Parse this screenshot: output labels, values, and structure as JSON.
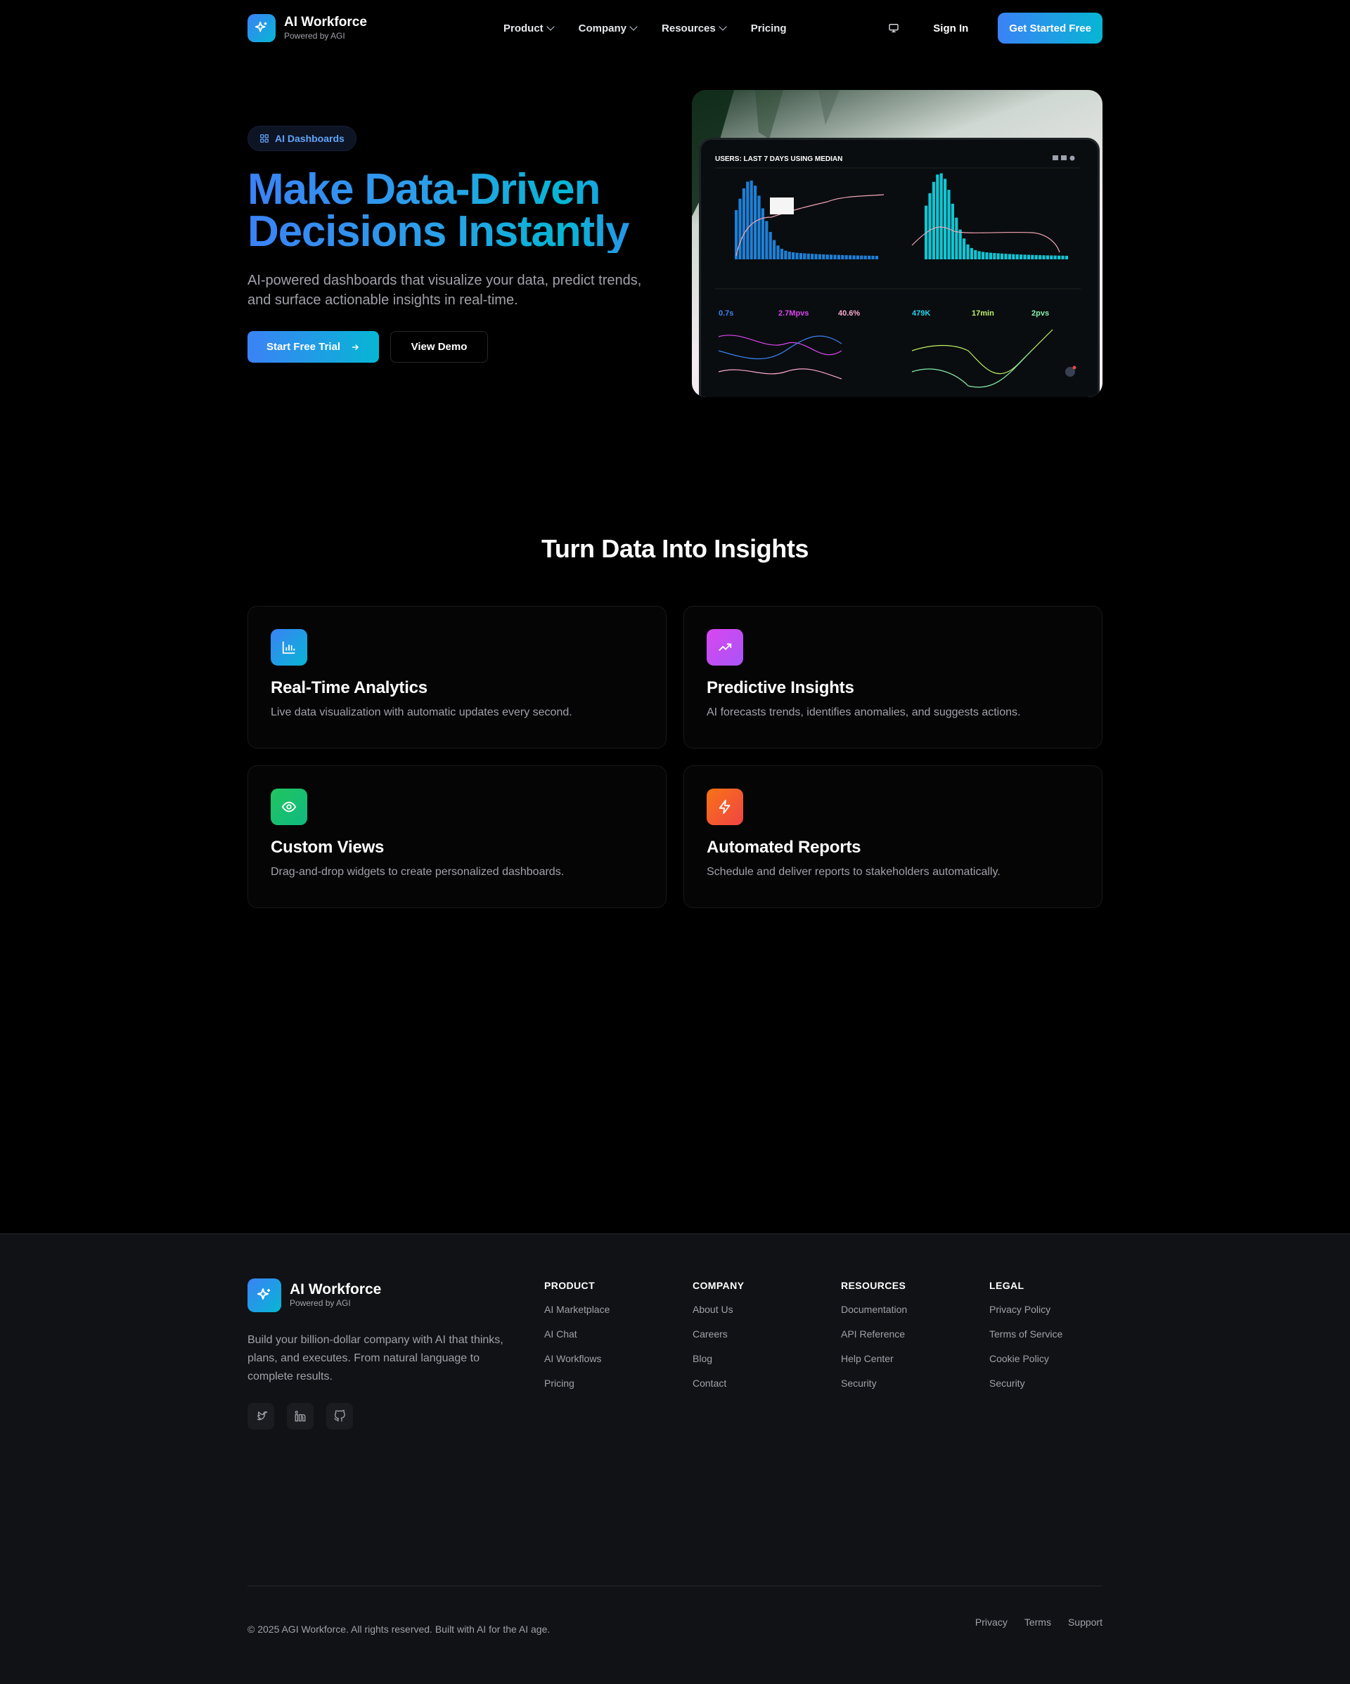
{
  "nav": {
    "brand": "AI Workforce",
    "brand_sub": "Powered by AGI",
    "links": [
      {
        "label": "Product",
        "has_menu": true
      },
      {
        "label": "Company",
        "has_menu": true
      },
      {
        "label": "Resources",
        "has_menu": true
      },
      {
        "label": "Pricing",
        "has_menu": false
      }
    ],
    "icon": "monitor-icon",
    "signin": "Sign In",
    "cta": "Get Started Free"
  },
  "hero": {
    "badge": "AI Dashboards",
    "title_line1": "Make Data-Driven",
    "title_line2": "Decisions Instantly",
    "lede": "AI-powered dashboards that visualize your data, predict trends, and surface actionable insights in real-time.",
    "primary_button": "Start Free Trial",
    "secondary_button": "View Demo",
    "screen_header": "USERS: LAST 7 DAYS USING MEDIAN"
  },
  "features": {
    "title": "Turn Data Into Insights",
    "cards": [
      {
        "title": "Real-Time Analytics",
        "text": "Live data visualization with automatic updates every second.",
        "icon": "bar-chart-icon",
        "color": "#3b82f6"
      },
      {
        "title": "Predictive Insights",
        "text": "AI forecasts trends, identifies anomalies, and suggests actions.",
        "icon": "trending-up-icon",
        "color": "#d946ef"
      },
      {
        "title": "Custom Views",
        "text": "Drag-and-drop widgets to create personalized dashboards.",
        "icon": "eye-icon",
        "color": "#22c55e"
      },
      {
        "title": "Automated Reports",
        "text": "Schedule and deliver reports to stakeholders automatically.",
        "icon": "zap-icon",
        "color": "#f97316"
      }
    ]
  },
  "footer": {
    "brand": "AI Workforce",
    "brand_sub": "Powered by AGI",
    "desc": "Build your billion-dollar company with AI that thinks, plans, and executes. From natural language to complete results.",
    "columns": [
      {
        "heading": "PRODUCT",
        "links": [
          "AI Marketplace",
          "AI Chat",
          "AI Workflows",
          "Pricing"
        ]
      },
      {
        "heading": "COMPANY",
        "links": [
          "About Us",
          "Careers",
          "Blog",
          "Contact"
        ]
      },
      {
        "heading": "RESOURCES",
        "links": [
          "Documentation",
          "API Reference",
          "Help Center",
          "Security"
        ]
      },
      {
        "heading": "LEGAL",
        "links": [
          "Privacy Policy",
          "Terms of Service",
          "Cookie Policy",
          "Security"
        ]
      }
    ],
    "copyright": "© 2025 AGI Workforce. All rights reserved. Built with AI for the AI age.",
    "bottom_links": [
      "Privacy",
      "Terms",
      "Support"
    ]
  }
}
